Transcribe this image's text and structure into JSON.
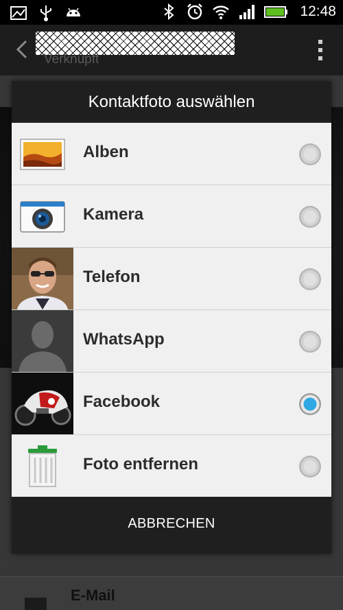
{
  "status_bar": {
    "time": "12:48",
    "icons_left": [
      "picture-icon",
      "usb-icon",
      "android-icon"
    ],
    "icons_right": [
      "bluetooth-icon",
      "alarm-icon",
      "wifi-icon",
      "signal-icon",
      "battery-icon"
    ],
    "battery_color": "#5ec01e"
  },
  "action_bar": {
    "subtitle": "Verknüpft"
  },
  "dialog": {
    "title": "Kontaktfoto auswählen",
    "options": [
      {
        "label": "Alben",
        "icon": "album-icon",
        "checked": false
      },
      {
        "label": "Kamera",
        "icon": "camera-icon",
        "checked": false
      },
      {
        "label": "Telefon",
        "icon": "person-photo",
        "checked": false
      },
      {
        "label": "WhatsApp",
        "icon": "default-avatar-icon",
        "checked": false
      },
      {
        "label": "Facebook",
        "icon": "motorcycle-photo",
        "checked": true
      },
      {
        "label": "Foto entfernen",
        "icon": "trash-icon",
        "checked": false
      }
    ],
    "cancel_label": "ABBRECHEN",
    "accent_color": "#2fa8e4"
  },
  "page": {
    "email_label": "E-Mail"
  }
}
